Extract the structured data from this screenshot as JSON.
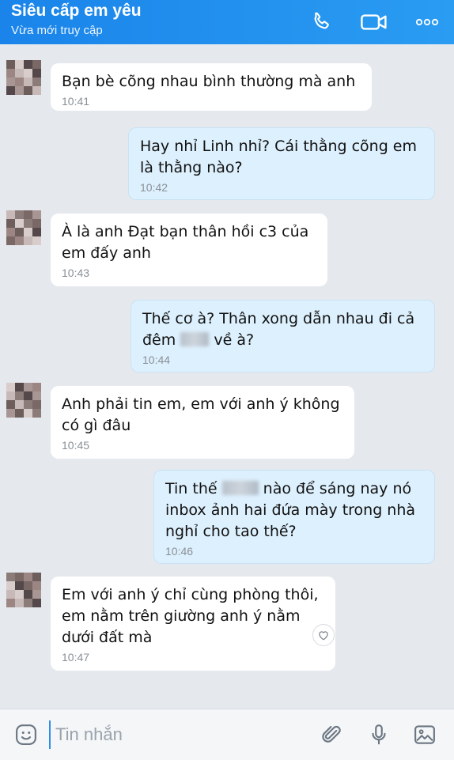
{
  "header": {
    "contact_name": "Siêu cấp em yêu",
    "status": "Vừa mới truy cập",
    "icons": [
      "phone-icon",
      "video-call-icon",
      "more-icon"
    ]
  },
  "colors": {
    "header_start": "#1a84ea",
    "header_end": "#2a9cf2",
    "incoming_bubble": "#ffffff",
    "outgoing_bubble": "#ddf0fd",
    "background": "#e5e9ee"
  },
  "messages": [
    {
      "direction": "incoming",
      "text": "Bạn bè cõng nhau bình thường mà anh",
      "time": "10:41"
    },
    {
      "direction": "outgoing",
      "text": "Hay nhỉ Linh nhỉ? Cái thằng cõng em\nlà thằng nào?",
      "time": "10:42"
    },
    {
      "direction": "incoming",
      "text": "À là anh Đạt bạn thân hồi c3 của\nem đấy anh",
      "time": "10:43"
    },
    {
      "direction": "outgoing",
      "text_a": "Thế cơ à? Thân xong dẫn nhau đi cả\nđêm",
      "text_b": "về à?",
      "time": "10:44"
    },
    {
      "direction": "incoming",
      "text": "Anh phải tin em, em với anh ý không\ncó gì đâu",
      "time": "10:45"
    },
    {
      "direction": "outgoing",
      "text_a": "Tin thế",
      "text_b": "nào để sáng nay nó\ninbox ảnh hai đứa mày trong nhà\nnghỉ cho tao thế?",
      "time": "10:46"
    },
    {
      "direction": "incoming",
      "text": "Em với anh ý chỉ cùng phòng thôi,\nem nằm trên giường anh ý nằm\ndưới đất mà",
      "time": "10:47"
    }
  ],
  "composer": {
    "placeholder": "Tin nhắn",
    "icons": [
      "emoji-icon",
      "attachment-icon",
      "microphone-icon",
      "image-icon"
    ]
  }
}
